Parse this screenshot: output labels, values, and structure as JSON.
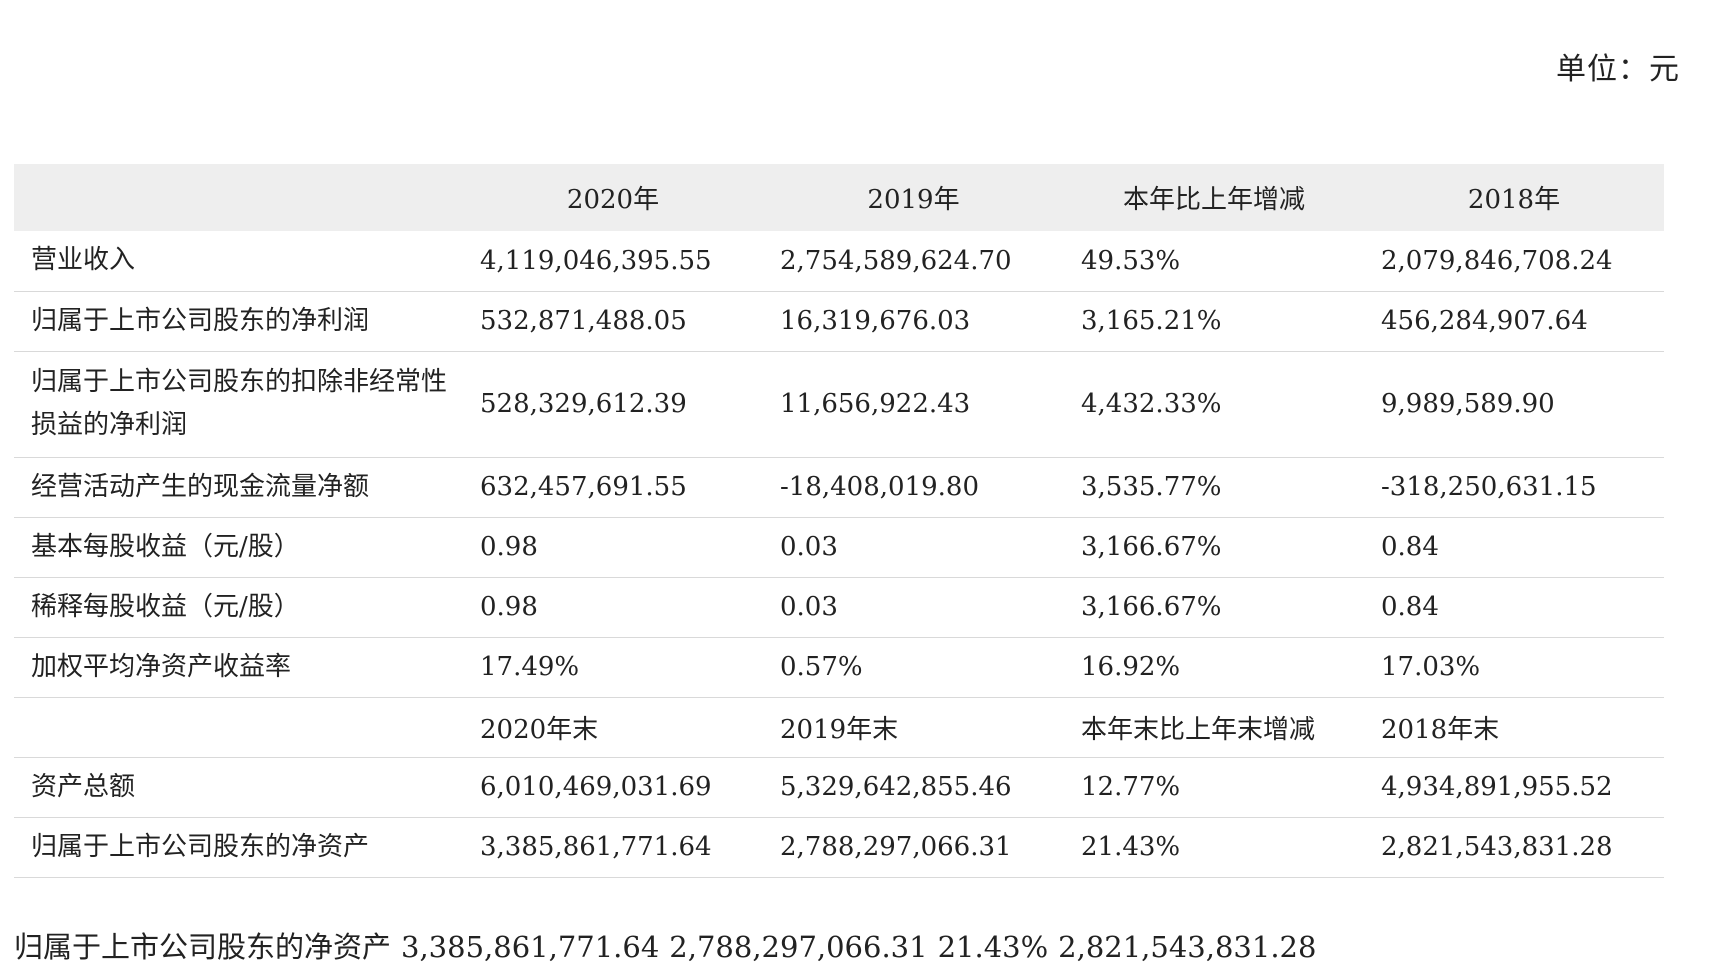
{
  "unit_label": "单位：元",
  "header": {
    "blank": "",
    "col1": "2020年",
    "col2": "2019年",
    "col3": "本年比上年增减",
    "col4": "2018年"
  },
  "rows": [
    {
      "label": "营业收入",
      "v2020": "4,119,046,395.55",
      "v2019": "2,754,589,624.70",
      "change": "49.53%",
      "v2018": "2,079,846,708.24"
    },
    {
      "label": "归属于上市公司股东的净利润",
      "v2020": "532,871,488.05",
      "v2019": "16,319,676.03",
      "change": "3,165.21%",
      "v2018": "456,284,907.64"
    },
    {
      "label": "归属于上市公司股东的扣除非经常性损益的净利润",
      "v2020": "528,329,612.39",
      "v2019": "11,656,922.43",
      "change": "4,432.33%",
      "v2018": "9,989,589.90"
    },
    {
      "label": "经营活动产生的现金流量净额",
      "v2020": "632,457,691.55",
      "v2019": "-18,408,019.80",
      "change": "3,535.77%",
      "v2018": "-318,250,631.15"
    },
    {
      "label": "基本每股收益（元/股）",
      "v2020": "0.98",
      "v2019": "0.03",
      "change": "3,166.67%",
      "v2018": "0.84"
    },
    {
      "label": "稀释每股收益（元/股）",
      "v2020": "0.98",
      "v2019": "0.03",
      "change": "3,166.67%",
      "v2018": "0.84"
    },
    {
      "label": "加权平均净资产收益率",
      "v2020": "17.49%",
      "v2019": "0.57%",
      "change": "16.92%",
      "v2018": "17.03%"
    },
    {
      "label": "",
      "v2020": "2020年末",
      "v2019": "2019年末",
      "change": "本年末比上年末增减",
      "v2018": "2018年末"
    },
    {
      "label": "资产总额",
      "v2020": "6,010,469,031.69",
      "v2019": "5,329,642,855.46",
      "change": "12.77%",
      "v2018": "4,934,891,955.52"
    },
    {
      "label": "归属于上市公司股东的净资产",
      "v2020": "3,385,861,771.64",
      "v2019": "2,788,297,066.31",
      "change": "21.43%",
      "v2018": "2,821,543,831.28"
    }
  ],
  "footer": {
    "label": "归属于上市公司股东的净资产",
    "v2020": "3,385,861,771.64",
    "v2019": "2,788,297,066.31",
    "change": "21.43%",
    "v2018": "2,821,543,831.28"
  }
}
